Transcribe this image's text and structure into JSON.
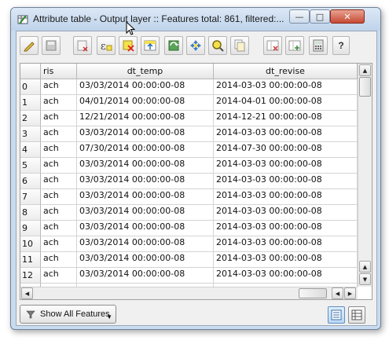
{
  "window": {
    "title": "Attribute table - Output layer :: Features total: 861, filtered:..."
  },
  "toolbar": {
    "buttons": [
      {
        "icon": "pencil-edit-icon"
      },
      {
        "icon": "save-edits-icon"
      },
      {
        "icon": "delete-selected-icon"
      },
      {
        "icon": "select-by-expression-icon"
      },
      {
        "icon": "deselect-all-icon"
      },
      {
        "icon": "move-selection-to-top-icon"
      },
      {
        "icon": "invert-selection-icon"
      },
      {
        "icon": "pan-map-to-selected-icon"
      },
      {
        "icon": "zoom-map-to-selected-icon"
      },
      {
        "icon": "copy-selected-rows-icon"
      },
      {
        "icon": "delete-column-icon"
      },
      {
        "icon": "new-column-icon"
      },
      {
        "icon": "field-calculator-icon"
      },
      {
        "icon": "help-icon"
      }
    ],
    "help_label": "?"
  },
  "table": {
    "columns": [
      "ris",
      "dt_temp",
      "dt_revise"
    ],
    "rows": [
      {
        "id": "0",
        "ris": "ach",
        "dt_temp": "03/03/2014 00:00:00-08",
        "dt_revise": "2014-03-03 00:00:00-08"
      },
      {
        "id": "1",
        "ris": "ach",
        "dt_temp": "04/01/2014 00:00:00-08",
        "dt_revise": "2014-04-01 00:00:00-08"
      },
      {
        "id": "2",
        "ris": "ach",
        "dt_temp": "12/21/2014 00:00:00-08",
        "dt_revise": "2014-12-21 00:00:00-08"
      },
      {
        "id": "3",
        "ris": "ach",
        "dt_temp": "03/03/2014 00:00:00-08",
        "dt_revise": "2014-03-03 00:00:00-08"
      },
      {
        "id": "4",
        "ris": "ach",
        "dt_temp": "07/30/2014 00:00:00-08",
        "dt_revise": "2014-07-30 00:00:00-08"
      },
      {
        "id": "5",
        "ris": "ach",
        "dt_temp": "03/03/2014 00:00:00-08",
        "dt_revise": "2014-03-03 00:00:00-08"
      },
      {
        "id": "6",
        "ris": "ach",
        "dt_temp": "03/03/2014 00:00:00-08",
        "dt_revise": "2014-03-03 00:00:00-08"
      },
      {
        "id": "7",
        "ris": "ach",
        "dt_temp": "03/03/2014 00:00:00-08",
        "dt_revise": "2014-03-03 00:00:00-08"
      },
      {
        "id": "8",
        "ris": "ach",
        "dt_temp": "03/03/2014 00:00:00-08",
        "dt_revise": "2014-03-03 00:00:00-08"
      },
      {
        "id": "9",
        "ris": "ach",
        "dt_temp": "03/03/2014 00:00:00-08",
        "dt_revise": "2014-03-03 00:00:00-08"
      },
      {
        "id": "10",
        "ris": "ach",
        "dt_temp": "03/03/2014 00:00:00-08",
        "dt_revise": "2014-03-03 00:00:00-08"
      },
      {
        "id": "11",
        "ris": "ach",
        "dt_temp": "03/03/2014 00:00:00-08",
        "dt_revise": "2014-03-03 00:00:00-08"
      },
      {
        "id": "12",
        "ris": "ach",
        "dt_temp": "03/03/2014 00:00:00-08",
        "dt_revise": "2014-03-03 00:00:00-08"
      }
    ]
  },
  "bottom": {
    "show_features_label": "Show All Features"
  }
}
